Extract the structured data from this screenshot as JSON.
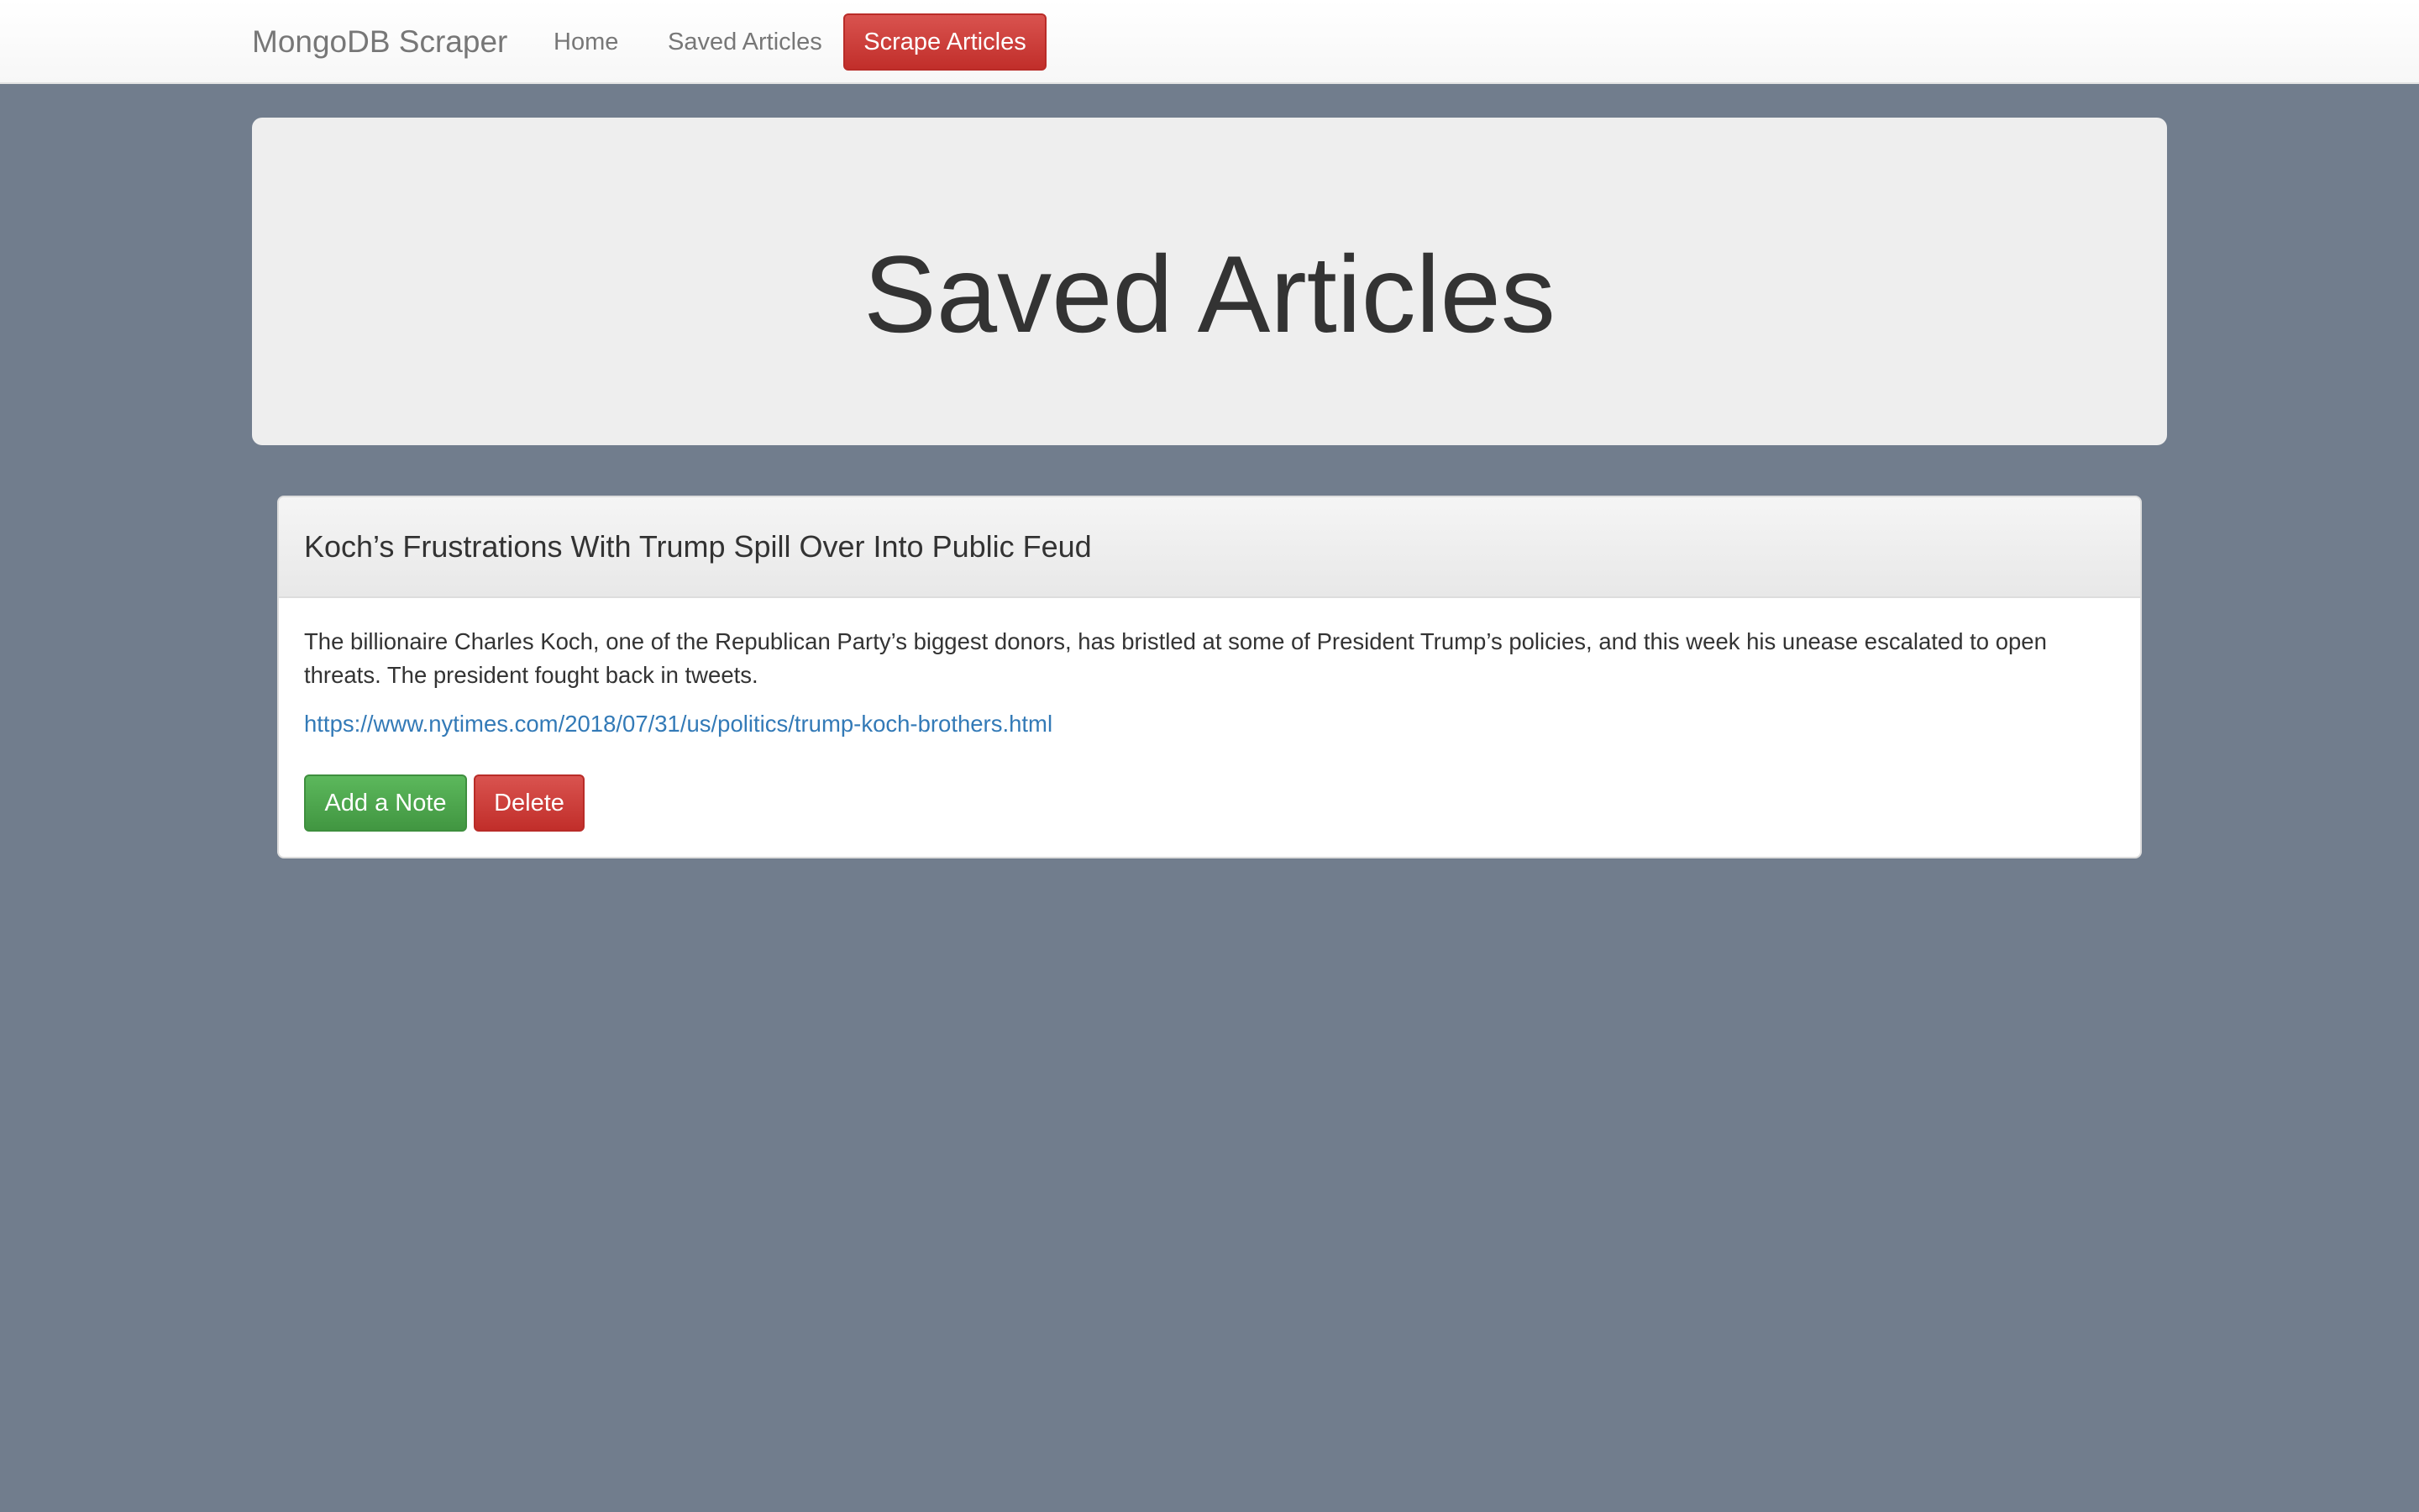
{
  "navbar": {
    "brand": "MongoDB Scraper",
    "links": [
      "Home",
      "Saved Articles"
    ],
    "scrape_button": "Scrape Articles"
  },
  "jumbotron": {
    "title": "Saved Articles"
  },
  "articles": [
    {
      "title": "Koch’s Frustrations With Trump Spill Over Into Public Feud",
      "summary": "The billionaire Charles Koch, one of the Republican Party’s biggest donors, has bristled at some of President Trump’s policies, and this week his unease escalated to open threats. The president fought back in tweets.",
      "url": "https://www.nytimes.com/2018/07/31/us/politics/trump-koch-brothers.html",
      "add_note_label": "Add a Note",
      "delete_label": "Delete"
    }
  ],
  "colors": {
    "page_background": "#717d8d",
    "danger": "#d9534f",
    "success": "#5cb85c",
    "link": "#337ab7",
    "jumbotron": "#eeeeee"
  }
}
